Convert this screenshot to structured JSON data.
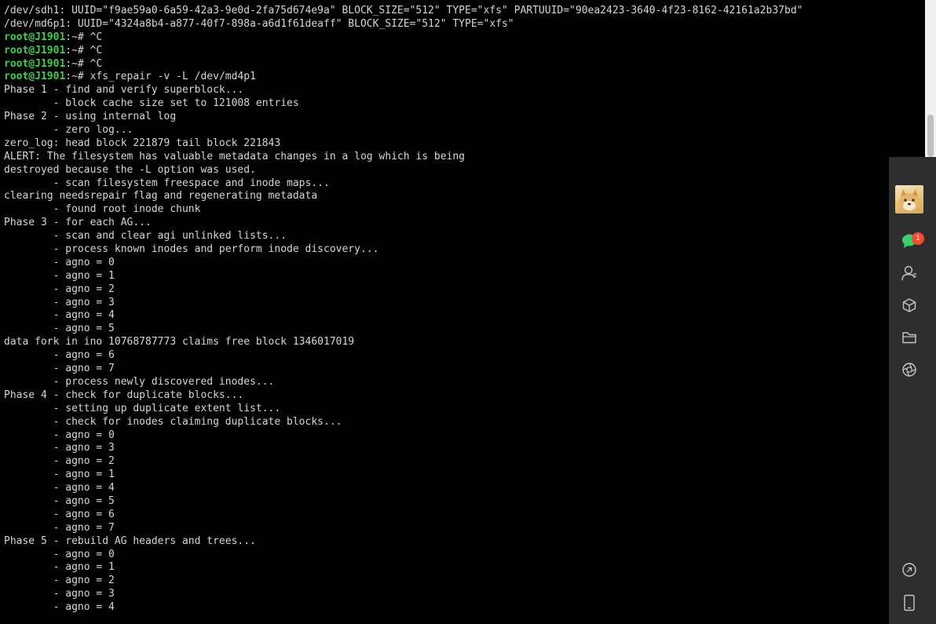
{
  "terminal": {
    "lines": [
      {
        "text": "/dev/sdh1: UUID=\"f9ae59a0-6a59-42a3-9e0d-2fa75d674e9a\" BLOCK_SIZE=\"512\" TYPE=\"xfs\" PARTUUID=\"90ea2423-3640-4f23-8162-42161a2b37bd\""
      },
      {
        "text": "/dev/md6p1: UUID=\"4324a8b4-a877-40f7-898a-a6d1f61deaff\" BLOCK_SIZE=\"512\" TYPE=\"xfs\""
      },
      {
        "user": "root@J1901",
        "rest": ":~# ^C"
      },
      {
        "user": "root@J1901",
        "rest": ":~# ^C"
      },
      {
        "user": "root@J1901",
        "rest": ":~# ^C"
      },
      {
        "user": "root@J1901",
        "rest": ":~# xfs_repair -v -L /dev/md4p1"
      },
      {
        "text": "Phase 1 - find and verify superblock..."
      },
      {
        "text": "        - block cache size set to 121008 entries"
      },
      {
        "text": "Phase 2 - using internal log"
      },
      {
        "text": "        - zero log..."
      },
      {
        "text": "zero_log: head block 221879 tail block 221843"
      },
      {
        "text": "ALERT: The filesystem has valuable metadata changes in a log which is being"
      },
      {
        "text": "destroyed because the -L option was used."
      },
      {
        "text": "        - scan filesystem freespace and inode maps..."
      },
      {
        "text": "clearing needsrepair flag and regenerating metadata"
      },
      {
        "text": "        - found root inode chunk"
      },
      {
        "text": "Phase 3 - for each AG..."
      },
      {
        "text": "        - scan and clear agi unlinked lists..."
      },
      {
        "text": "        - process known inodes and perform inode discovery..."
      },
      {
        "text": "        - agno = 0"
      },
      {
        "text": "        - agno = 1"
      },
      {
        "text": "        - agno = 2"
      },
      {
        "text": "        - agno = 3"
      },
      {
        "text": "        - agno = 4"
      },
      {
        "text": "        - agno = 5"
      },
      {
        "text": "data fork in ino 10768787773 claims free block 1346017019"
      },
      {
        "text": "        - agno = 6"
      },
      {
        "text": "        - agno = 7"
      },
      {
        "text": "        - process newly discovered inodes..."
      },
      {
        "text": "Phase 4 - check for duplicate blocks..."
      },
      {
        "text": "        - setting up duplicate extent list..."
      },
      {
        "text": "        - check for inodes claiming duplicate blocks..."
      },
      {
        "text": "        - agno = 0"
      },
      {
        "text": "        - agno = 3"
      },
      {
        "text": "        - agno = 2"
      },
      {
        "text": "        - agno = 1"
      },
      {
        "text": "        - agno = 4"
      },
      {
        "text": "        - agno = 5"
      },
      {
        "text": "        - agno = 6"
      },
      {
        "text": "        - agno = 7"
      },
      {
        "text": "Phase 5 - rebuild AG headers and trees..."
      },
      {
        "text": "        - agno = 0"
      },
      {
        "text": "        - agno = 1"
      },
      {
        "text": "        - agno = 2"
      },
      {
        "text": "        - agno = 3"
      },
      {
        "text": "        - agno = 4"
      }
    ]
  },
  "dock": {
    "items": [
      {
        "icon": "avatar"
      },
      {
        "icon": "chat-icon",
        "badge": "1"
      },
      {
        "icon": "contacts-icon"
      },
      {
        "icon": "cube-icon"
      },
      {
        "icon": "folder-icon"
      },
      {
        "icon": "aperture-icon"
      },
      {
        "icon": "link-icon"
      },
      {
        "icon": "phone-icon"
      }
    ]
  },
  "colors": {
    "background": "#000000",
    "text": "#d6d6d6",
    "prompt_user": "#3ad24a",
    "dock_bg": "#2e2e2e",
    "badge": "#f74c31",
    "chat_green": "#3ecf6a"
  }
}
